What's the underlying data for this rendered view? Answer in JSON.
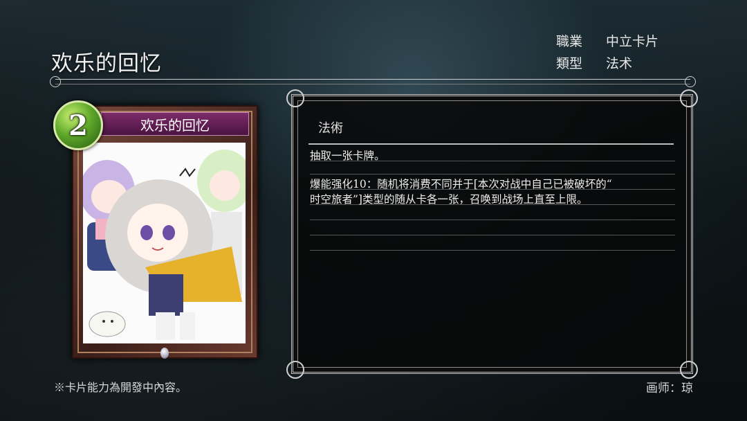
{
  "card": {
    "name": "欢乐的回忆",
    "cost": "2"
  },
  "meta": {
    "class_label": "職業",
    "class_value": "中立卡片",
    "type_label": "類型",
    "type_value": "法术"
  },
  "description": {
    "type_label": "法術",
    "lines": [
      "抽取一张卡牌。",
      "爆能强化10：随机将消费不同并于[本次对战中自己已被破坏的“",
      "时空旅者”]类型的随从卡各一张，召唤到战场上直至上限。"
    ]
  },
  "footer": {
    "note": "※卡片能力為開發中內容。",
    "artist": "画师：琼"
  },
  "colors": {
    "cost_gem": "#5fa82a",
    "name_bar": "#7c2c6a",
    "card_frame": "#6b3a2f"
  }
}
